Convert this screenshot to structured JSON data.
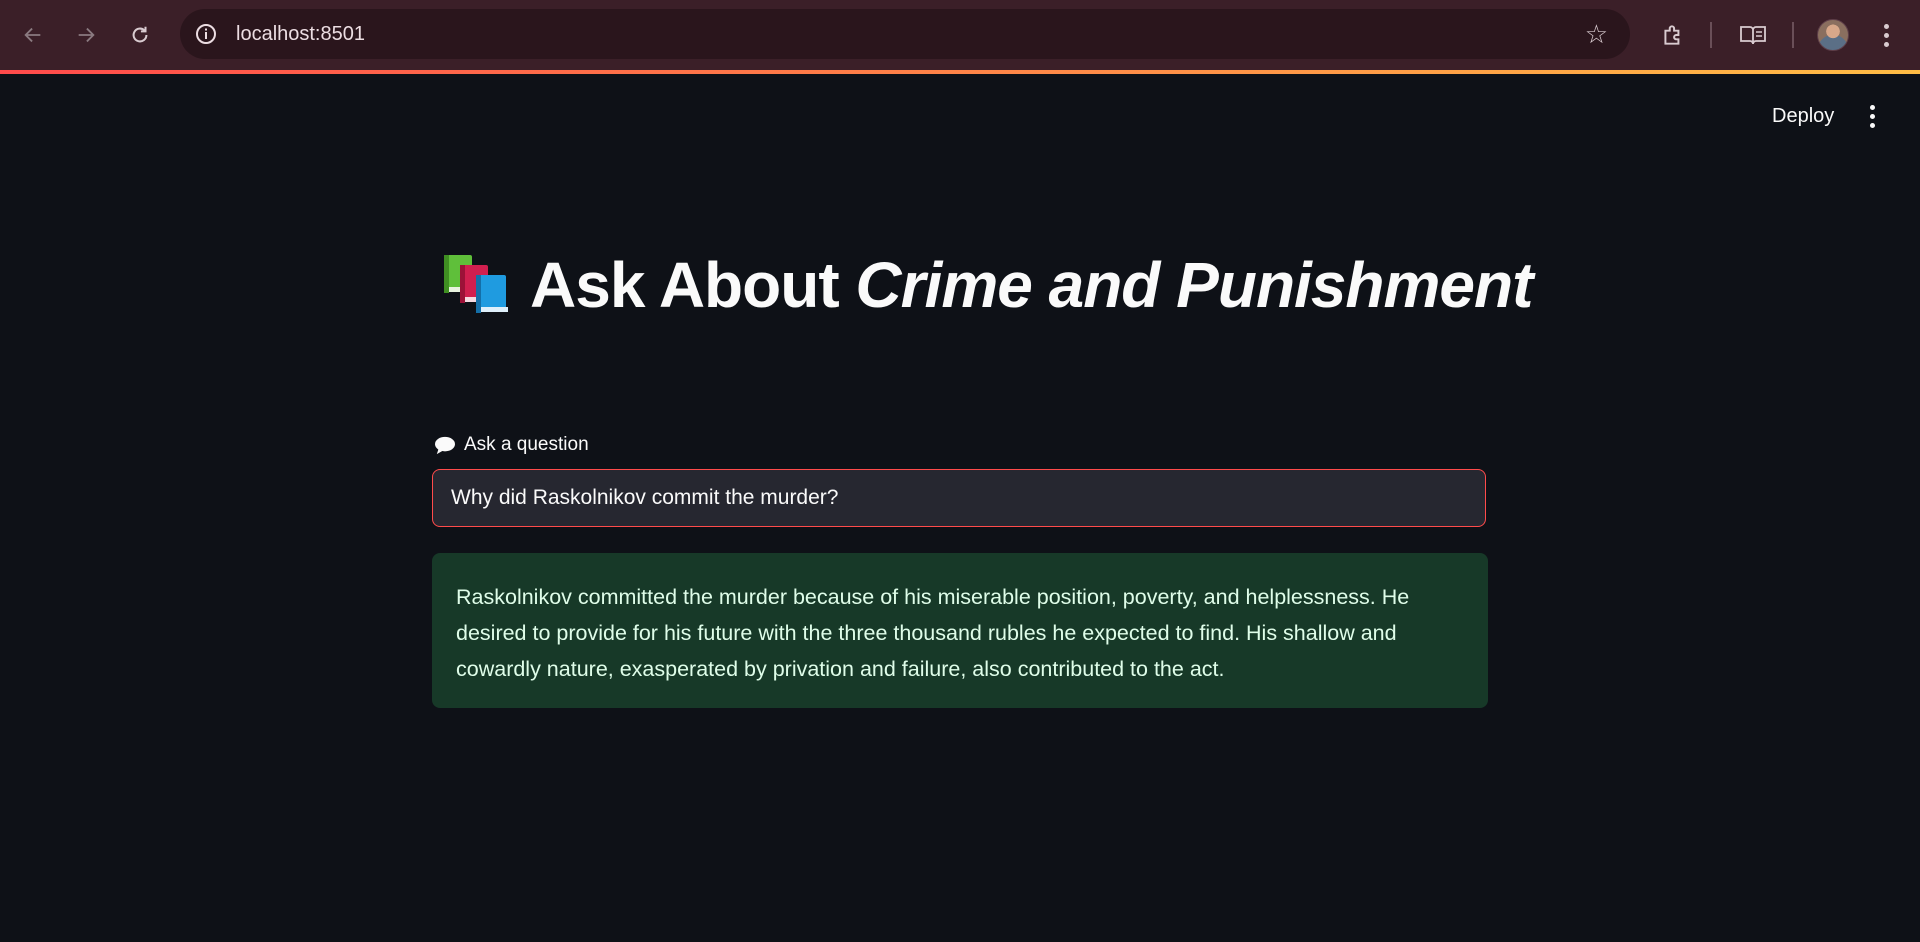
{
  "browser": {
    "url": "localhost:8501",
    "icons": [
      "back-icon",
      "forward-icon",
      "reload-icon",
      "info-icon",
      "star-icon",
      "extensions-icon",
      "reading-mode-icon",
      "avatar",
      "menu-icon"
    ]
  },
  "header": {
    "deploy_label": "Deploy"
  },
  "app": {
    "title_emoji": "📚",
    "title_plain": "Ask About ",
    "title_italic": "Crime and Punishment",
    "question_label_icon": "💬",
    "question_label": "Ask a question",
    "question_value": "Why did Raskolnikov commit the murder?",
    "answer": "Raskolnikov committed the murder because of his miserable position, poverty, and helplessness. He desired to provide for his future with the three thousand rubles he expected to find. His shallow and cowardly nature, exasperated by privation and failure, also contributed to the act."
  },
  "colors": {
    "background": "#0e1117",
    "chrome": "#3b1f28",
    "accent": "#ff4b4b",
    "answer_bg": "#173928",
    "answer_text": "#dffde9"
  }
}
